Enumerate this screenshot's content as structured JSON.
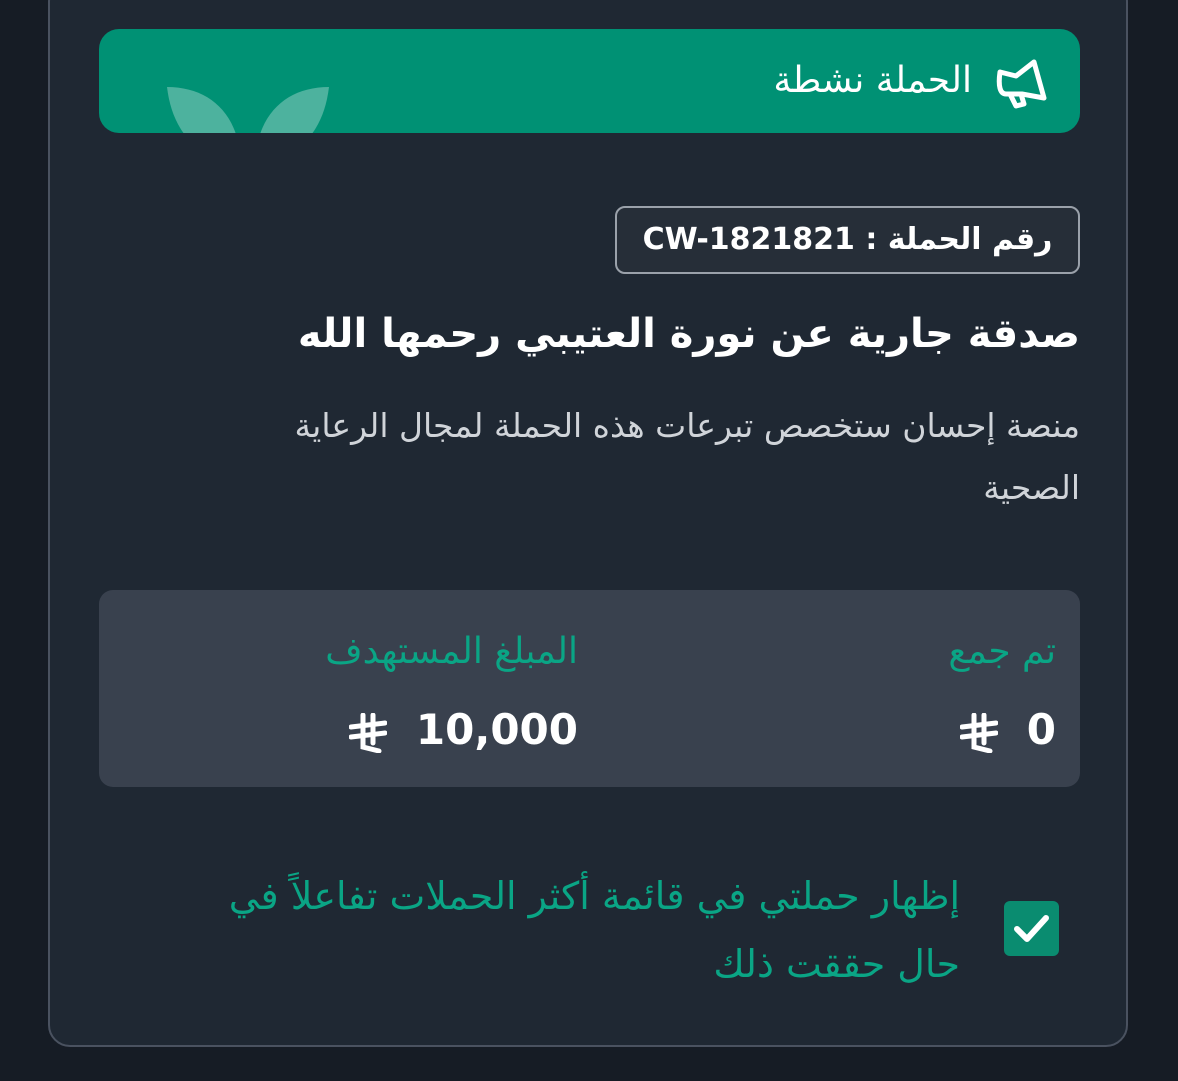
{
  "banner": {
    "status_text": "الحملة نشطة",
    "color": "#009174"
  },
  "campaign": {
    "code_text": "رقم الحملة : CW-1821821",
    "title": "صدقة جارية عن نورة العتيبي رحمها الله",
    "description": "منصة إحسان ستخصص تبرعات هذه الحملة لمجال الرعاية الصحية"
  },
  "stats": {
    "collected_label": "تم جمع",
    "collected_value": "0",
    "target_label": "المبلغ المستهدف",
    "target_value": "10,000",
    "currency_icon": "riyal-icon",
    "accent_color": "#0aa585"
  },
  "option": {
    "checked": true,
    "label": "إظهار حملتي في قائمة أكثر الحملات تفاعلاً في حال حققت ذلك"
  }
}
